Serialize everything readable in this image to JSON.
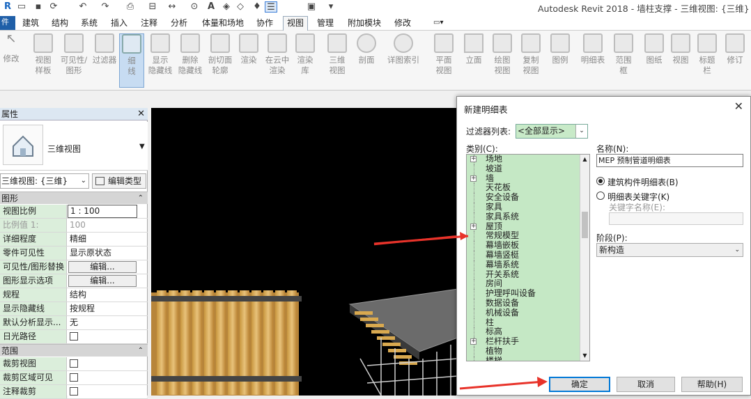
{
  "app_title": "Autodesk Revit 2018 -    墙柱支撑 - 三维视图: {三维}",
  "ribbon_tabs": [
    "建筑",
    "结构",
    "系统",
    "插入",
    "注释",
    "分析",
    "体量和场地",
    "协作",
    "视图",
    "管理",
    "附加模块",
    "修改"
  ],
  "ribbon_tools": [
    {
      "label1": "修改",
      "label2": ""
    },
    {
      "label1": "视图",
      "label2": "样板"
    },
    {
      "label1": "可见性/",
      "label2": "图形"
    },
    {
      "label1": "过滤器",
      "label2": ""
    },
    {
      "label1": "细",
      "label2": "线"
    },
    {
      "label1": "显示",
      "label2": "隐藏线"
    },
    {
      "label1": "删除",
      "label2": "隐藏线"
    },
    {
      "label1": "剖切面",
      "label2": "轮廓"
    },
    {
      "label1": "渲染",
      "label2": ""
    },
    {
      "label1": "在云中",
      "label2": "渲染"
    },
    {
      "label1": "渲染",
      "label2": "库"
    },
    {
      "label1": "三维",
      "label2": "视图"
    },
    {
      "label1": "剖面",
      "label2": ""
    },
    {
      "label1": "详图索引",
      "label2": ""
    },
    {
      "label1": "平面",
      "label2": "视图"
    },
    {
      "label1": "立面",
      "label2": ""
    },
    {
      "label1": "绘图",
      "label2": "视图"
    },
    {
      "label1": "复制",
      "label2": "视图"
    },
    {
      "label1": "图例",
      "label2": ""
    },
    {
      "label1": "明细表",
      "label2": ""
    },
    {
      "label1": "范围",
      "label2": "框"
    },
    {
      "label1": "图纸",
      "label2": ""
    },
    {
      "label1": "视图",
      "label2": ""
    },
    {
      "label1": "标题",
      "label2": "栏"
    },
    {
      "label1": "修订",
      "label2": ""
    }
  ],
  "properties": {
    "title": "属性",
    "type_name": "三维视图",
    "view_selector": "三维视图: {三维}",
    "edit_type": "编辑类型",
    "group_graphics": "图形",
    "group_range": "范围",
    "rows": [
      {
        "key": "视图比例",
        "value": "1 : 100"
      },
      {
        "key": "比例值 1:",
        "value": "100"
      },
      {
        "key": "详细程度",
        "value": "精细"
      },
      {
        "key": "零件可见性",
        "value": "显示原状态"
      },
      {
        "key": "可见性/图形替换",
        "value": "编辑..."
      },
      {
        "key": "图形显示选项",
        "value": "编辑..."
      },
      {
        "key": "规程",
        "value": "结构"
      },
      {
        "key": "显示隐藏线",
        "value": "按规程"
      },
      {
        "key": "默认分析显示...",
        "value": "无"
      },
      {
        "key": "日光路径",
        "value": ""
      }
    ],
    "range_rows": [
      {
        "key": "裁剪视图",
        "value": ""
      },
      {
        "key": "裁剪区域可见",
        "value": ""
      },
      {
        "key": "注释裁剪",
        "value": ""
      }
    ]
  },
  "dialog": {
    "title": "新建明细表",
    "filter_label": "过滤器列表:",
    "filter_value": "<全部显示>",
    "category_label": "类别(C):",
    "categories": [
      {
        "label": "场地",
        "expandable": true
      },
      {
        "label": "坡道",
        "expandable": false
      },
      {
        "label": "墙",
        "expandable": true
      },
      {
        "label": "天花板",
        "expandable": false
      },
      {
        "label": "安全设备",
        "expandable": false
      },
      {
        "label": "家具",
        "expandable": false
      },
      {
        "label": "家具系统",
        "expandable": false
      },
      {
        "label": "屋顶",
        "expandable": true
      },
      {
        "label": "常规模型",
        "expandable": false
      },
      {
        "label": "幕墙嵌板",
        "expandable": false
      },
      {
        "label": "幕墙竖梃",
        "expandable": false
      },
      {
        "label": "幕墙系统",
        "expandable": false
      },
      {
        "label": "开关系统",
        "expandable": false
      },
      {
        "label": "房间",
        "expandable": false
      },
      {
        "label": "护理呼叫设备",
        "expandable": false
      },
      {
        "label": "数据设备",
        "expandable": false
      },
      {
        "label": "机械设备",
        "expandable": false
      },
      {
        "label": "柱",
        "expandable": false
      },
      {
        "label": "标高",
        "expandable": false
      },
      {
        "label": "栏杆扶手",
        "expandable": true
      },
      {
        "label": "植物",
        "expandable": false
      },
      {
        "label": "楼梯",
        "expandable": false
      }
    ],
    "name_label": "名称(N):",
    "name_value": "MEP 预制管道明细表",
    "radio1": "建筑构件明细表(B)",
    "radio2": "明细表关键字(K)",
    "key_name_label": "关键字名称(E):",
    "phase_label": "阶段(P):",
    "phase_value": "新构造",
    "ok": "确定",
    "cancel": "取消",
    "help": "帮助(H)"
  },
  "colors": {
    "accent": "#0078d7",
    "category_bg": "#c5e8c5",
    "arrow": "#e8332a"
  }
}
